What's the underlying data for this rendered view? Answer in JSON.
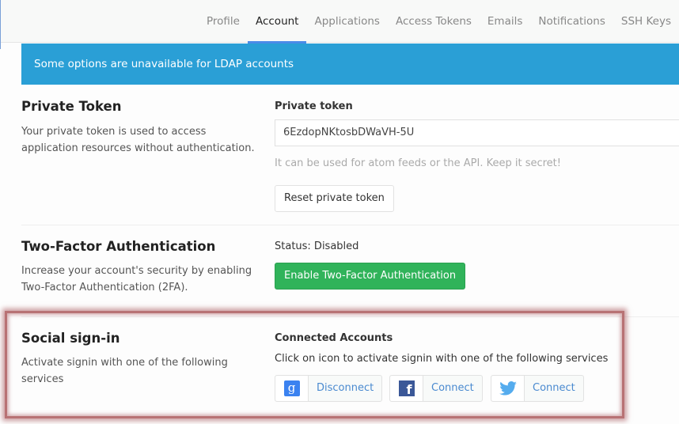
{
  "nav": {
    "tabs": [
      {
        "label": "Profile",
        "active": false
      },
      {
        "label": "Account",
        "active": true
      },
      {
        "label": "Applications",
        "active": false
      },
      {
        "label": "Access Tokens",
        "active": false
      },
      {
        "label": "Emails",
        "active": false
      },
      {
        "label": "Notifications",
        "active": false
      },
      {
        "label": "SSH Keys",
        "active": false
      }
    ]
  },
  "banner": {
    "text": "Some options are unavailable for LDAP accounts"
  },
  "private_token": {
    "title": "Private Token",
    "description": "Your private token is used to access application resources without authentication.",
    "label": "Private token",
    "value": "6EzdopNKtosbDWaVH-5U",
    "help": "It can be used for atom feeds or the API. Keep it secret!",
    "reset_label": "Reset private token"
  },
  "two_factor": {
    "title": "Two-Factor Authentication",
    "description": "Increase your account's security by enabling Two-Factor Authentication (2FA).",
    "status": "Status: Disabled",
    "enable_label": "Enable Two-Factor Authentication"
  },
  "social": {
    "title": "Social sign-in",
    "description": "Activate signin with one of the following services",
    "label": "Connected Accounts",
    "help": "Click on icon to activate signin with one of the following services",
    "services": [
      {
        "icon": "google-icon",
        "action": "Disconnect",
        "color": "#3b82f0"
      },
      {
        "icon": "facebook-icon",
        "action": "Connect",
        "color": "#3b5898"
      },
      {
        "icon": "twitter-icon",
        "action": "Connect",
        "color": "#55acee"
      }
    ]
  },
  "colors": {
    "banner": "#2a9fd6",
    "success": "#30b35a",
    "highlight": "#b87274"
  }
}
